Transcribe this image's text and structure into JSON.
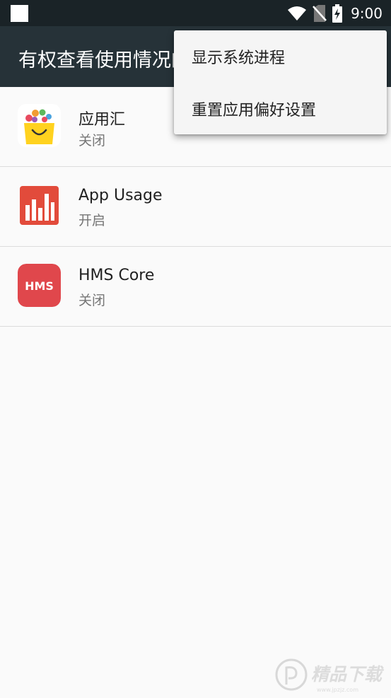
{
  "status_bar": {
    "time": "9:00",
    "icons": [
      "notification-icon",
      "wifi-icon",
      "no-sim-icon",
      "battery-charging-icon"
    ]
  },
  "app_bar": {
    "title": "有权查看使用情况的应用"
  },
  "apps": [
    {
      "name": "应用汇",
      "status": "关闭",
      "icon": "appchina-icon"
    },
    {
      "name": "App Usage",
      "status": "开启",
      "icon": "app-usage-icon"
    },
    {
      "name": "HMS Core",
      "status": "关闭",
      "icon": "hms-core-icon",
      "icon_text": "HMS"
    }
  ],
  "overflow_menu": {
    "items": [
      "显示系统进程",
      "重置应用偏好设置"
    ]
  },
  "watermark": {
    "text": "精品下载",
    "url": "www.jpzjz.com"
  },
  "colors": {
    "status_bar": "#1a2327",
    "app_bar": "#263238",
    "background": "#fafafa",
    "hms_red": "#e0474c",
    "usage_red": "#e24b3b"
  }
}
